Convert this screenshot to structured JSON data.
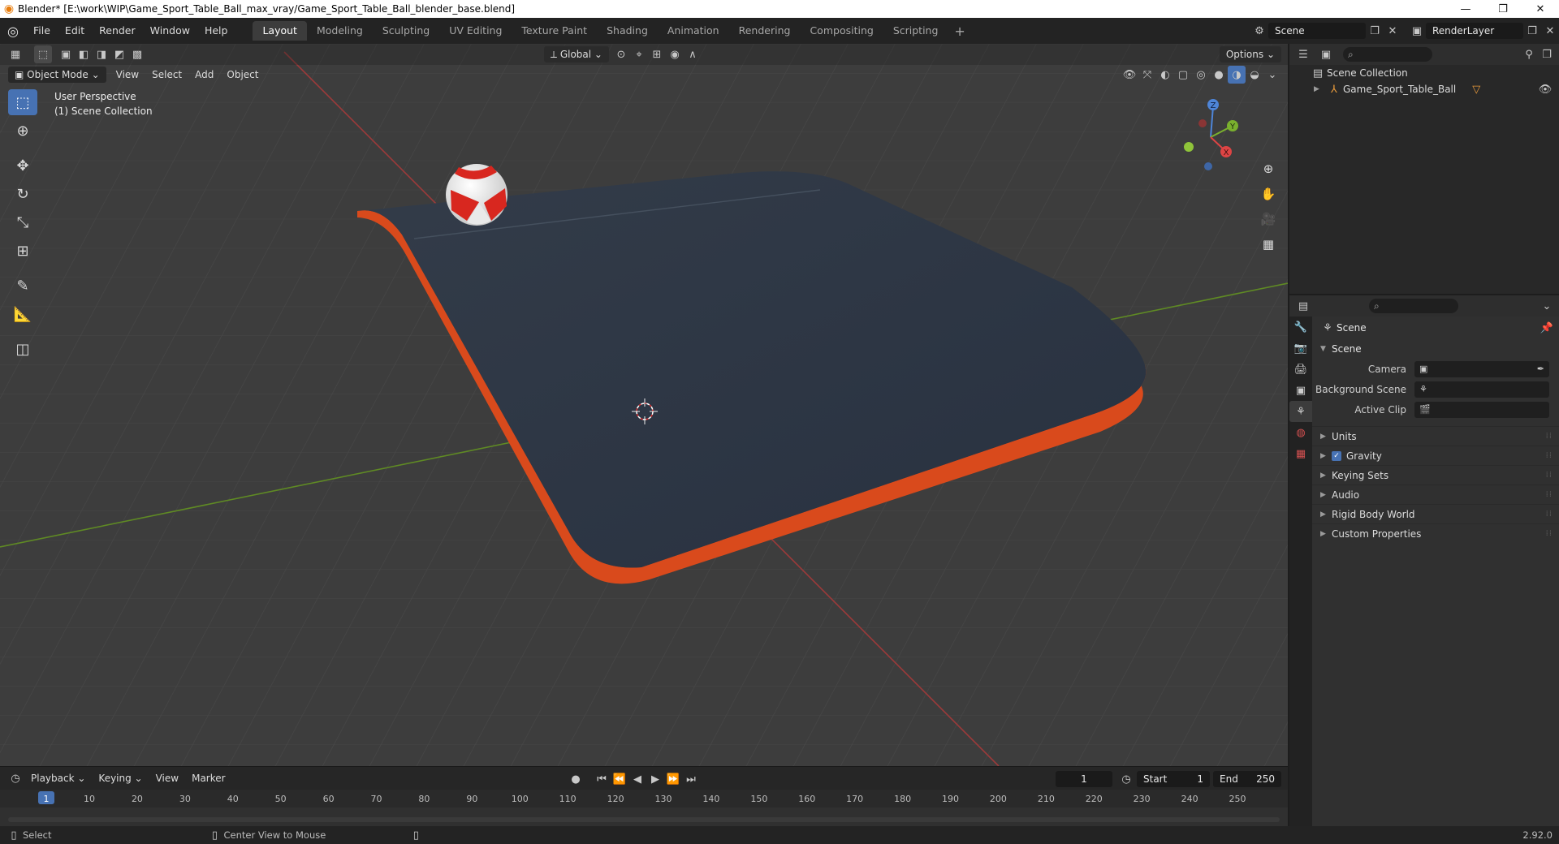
{
  "window": {
    "title": "Blender* [E:\\work\\WIP\\Game_Sport_Table_Ball_max_vray/Game_Sport_Table_Ball_blender_base.blend]",
    "minimize": "—",
    "restore": "❐",
    "close": "✕"
  },
  "menu": [
    "File",
    "Edit",
    "Render",
    "Window",
    "Help"
  ],
  "workspaces": [
    "Layout",
    "Modeling",
    "Sculpting",
    "UV Editing",
    "Texture Paint",
    "Shading",
    "Animation",
    "Rendering",
    "Compositing",
    "Scripting"
  ],
  "active_workspace": "Layout",
  "workspace_add": "+",
  "scene_selector": {
    "value": "Scene"
  },
  "view_layer_selector": {
    "value": "RenderLayer"
  },
  "viewport": {
    "transform_orientation": "Global",
    "options_label": "Options",
    "mode": "Object Mode",
    "menus": [
      "View",
      "Select",
      "Add",
      "Object"
    ],
    "overlay_line1": "User Perspective",
    "overlay_line2": "(1) Scene Collection"
  },
  "gizmo": {
    "x": "X",
    "y": "Y",
    "z": "Z"
  },
  "timeline": {
    "menus": [
      "Playback",
      "Keying",
      "View",
      "Marker"
    ],
    "current_frame": "1",
    "start_label": "Start",
    "start_value": "1",
    "end_label": "End",
    "end_value": "250",
    "ruler": [
      "1",
      "10",
      "20",
      "30",
      "40",
      "50",
      "60",
      "70",
      "80",
      "90",
      "100",
      "110",
      "120",
      "130",
      "140",
      "150",
      "160",
      "170",
      "180",
      "190",
      "200",
      "210",
      "220",
      "230",
      "240",
      "250"
    ]
  },
  "statusbar": {
    "select": "Select",
    "center_view": "Center View to Mouse",
    "version": "2.92.0"
  },
  "outliner": {
    "root": "Scene Collection",
    "items": [
      {
        "name": "Game_Sport_Table_Ball"
      }
    ]
  },
  "properties": {
    "context": "Scene",
    "panel": "Scene",
    "fields": [
      {
        "label": "Camera",
        "value": ""
      },
      {
        "label": "Background Scene",
        "value": ""
      },
      {
        "label": "Active Clip",
        "value": ""
      }
    ],
    "subpanels": [
      {
        "label": "Units"
      },
      {
        "label": "Gravity"
      },
      {
        "label": "Keying Sets"
      },
      {
        "label": "Audio"
      },
      {
        "label": "Rigid Body World"
      },
      {
        "label": "Custom Properties"
      }
    ]
  },
  "colors": {
    "accent": "#4772b3",
    "viewport_bg": "#3d3d3d",
    "table_top": "#2f3845",
    "table_edge": "#d94a1c",
    "x_axis": "#b83a3a",
    "y_axis": "#6c9a2a"
  }
}
